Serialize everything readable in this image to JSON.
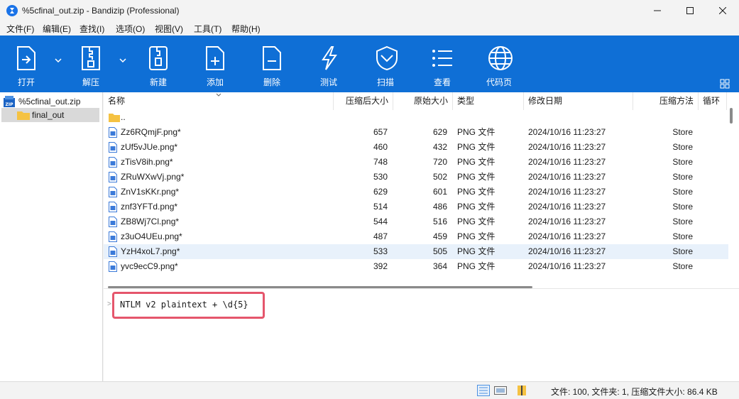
{
  "window": {
    "title": "%5cfinal_out.zip - Bandizip (Professional)",
    "controls": {
      "minimize": "—",
      "maximize": "☐",
      "close": "✕"
    }
  },
  "menu": [
    "文件(F)",
    "编辑(E)",
    "查找(I)",
    "选项(O)",
    "视图(V)",
    "工具(T)",
    "帮助(H)"
  ],
  "toolbar": {
    "buttons": [
      {
        "label": "打开",
        "icon": "open-icon"
      },
      {
        "label": "解压",
        "icon": "extract-icon"
      },
      {
        "label": "新建",
        "icon": "new-archive-icon"
      },
      {
        "label": "添加",
        "icon": "add-file-icon"
      },
      {
        "label": "删除",
        "icon": "delete-file-icon"
      },
      {
        "label": "测试",
        "icon": "test-icon"
      },
      {
        "label": "扫描",
        "icon": "scan-shield-icon"
      },
      {
        "label": "查看",
        "icon": "view-list-icon"
      },
      {
        "label": "代码页",
        "icon": "codepage-globe-icon"
      }
    ],
    "background": "#0f6fd6"
  },
  "tree": {
    "root": "%5cfinal_out.zip",
    "child": "final_out"
  },
  "columns": [
    "名称",
    "压缩后大小",
    "原始大小",
    "类型",
    "修改日期",
    "压缩方法",
    "循环"
  ],
  "parent_row": "..",
  "rows": [
    {
      "name": "Zz6RQmjF.png*",
      "compressed": "657",
      "original": "629",
      "type": "PNG 文件",
      "modified": "2024/10/16 11:23:27",
      "method": "Store"
    },
    {
      "name": "zUf5vJUe.png*",
      "compressed": "460",
      "original": "432",
      "type": "PNG 文件",
      "modified": "2024/10/16 11:23:27",
      "method": "Store"
    },
    {
      "name": "zTisV8ih.png*",
      "compressed": "748",
      "original": "720",
      "type": "PNG 文件",
      "modified": "2024/10/16 11:23:27",
      "method": "Store"
    },
    {
      "name": "ZRuWXwVj.png*",
      "compressed": "530",
      "original": "502",
      "type": "PNG 文件",
      "modified": "2024/10/16 11:23:27",
      "method": "Store"
    },
    {
      "name": "ZnV1sKKr.png*",
      "compressed": "629",
      "original": "601",
      "type": "PNG 文件",
      "modified": "2024/10/16 11:23:27",
      "method": "Store"
    },
    {
      "name": "znf3YFTd.png*",
      "compressed": "514",
      "original": "486",
      "type": "PNG 文件",
      "modified": "2024/10/16 11:23:27",
      "method": "Store"
    },
    {
      "name": "ZB8Wj7Cl.png*",
      "compressed": "544",
      "original": "516",
      "type": "PNG 文件",
      "modified": "2024/10/16 11:23:27",
      "method": "Store"
    },
    {
      "name": "z3uO4UEu.png*",
      "compressed": "487",
      "original": "459",
      "type": "PNG 文件",
      "modified": "2024/10/16 11:23:27",
      "method": "Store"
    },
    {
      "name": "YzH4xoL7.png*",
      "compressed": "533",
      "original": "505",
      "type": "PNG 文件",
      "modified": "2024/10/16 11:23:27",
      "method": "Store",
      "selected": true
    },
    {
      "name": "yvc9ecC9.png*",
      "compressed": "392",
      "original": "364",
      "type": "PNG 文件",
      "modified": "2024/10/16 11:23:27",
      "method": "Store"
    }
  ],
  "comment": "NTLM v2 plaintext + \\d{5}",
  "status": "文件: 100, 文件夹: 1, 压缩文件大小: 86.4 KB",
  "colors": {
    "accent": "#0f6fd6",
    "highlight_box": "#e5566c",
    "selected_row": "#e8f1fb"
  }
}
